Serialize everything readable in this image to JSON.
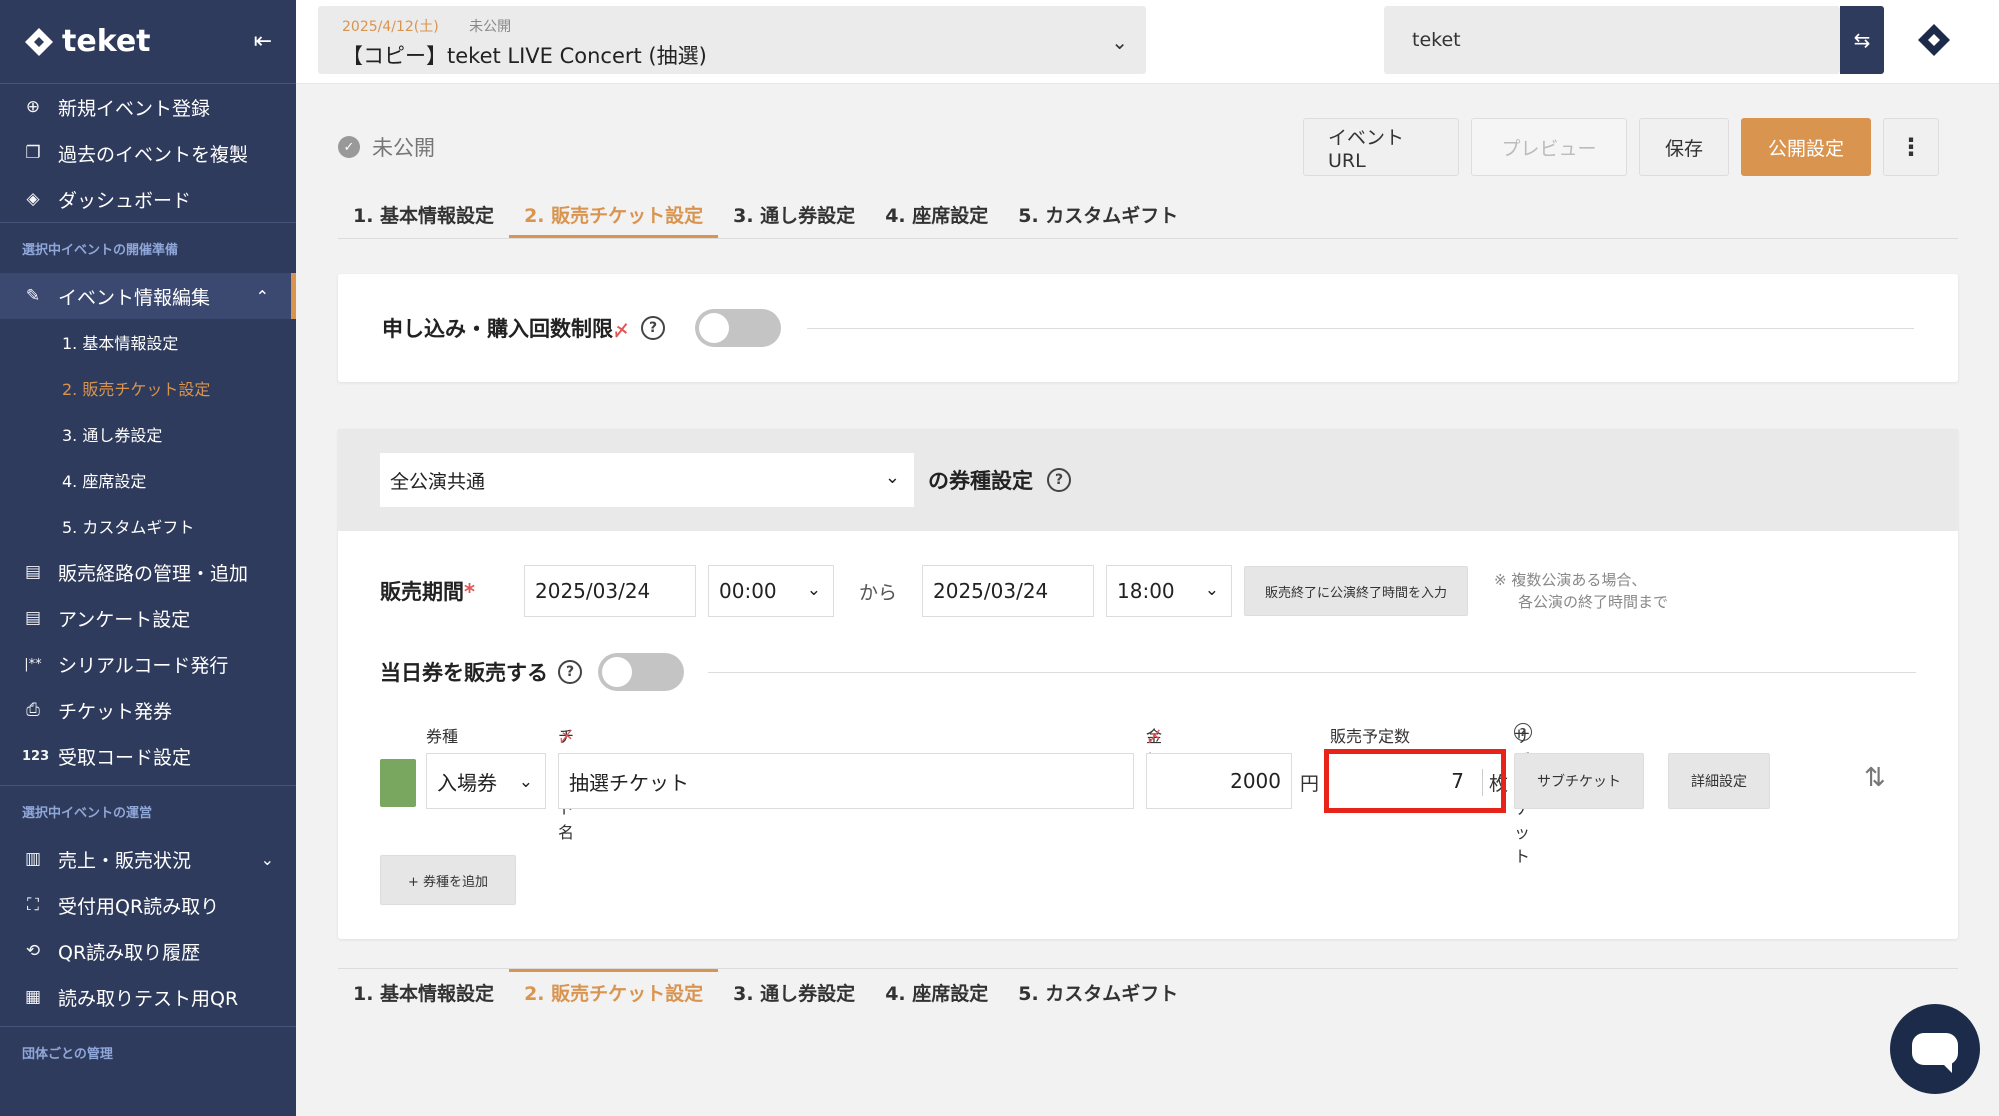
{
  "app": {
    "brand": "teket"
  },
  "sidebar": {
    "items_top": [
      {
        "label": "新規イベント登録",
        "icon": "plus-circle-icon"
      },
      {
        "label": "過去のイベントを複製",
        "icon": "copy-icon"
      },
      {
        "label": "ダッシュボード",
        "icon": "layers-icon"
      }
    ],
    "section_prep": "選択中イベントの開催準備",
    "edit_label": "イベント情報編集",
    "edit_subitems": [
      "1. 基本情報設定",
      "2. 販売チケット設定",
      "3. 通し券設定",
      "4. 座席設定",
      "5. カスタムギフト"
    ],
    "items_prep": [
      {
        "label": "販売経路の管理・追加",
        "icon": "doc-icon"
      },
      {
        "label": "アンケート設定",
        "icon": "doc-icon"
      },
      {
        "label": "シリアルコード発行",
        "icon": "asterisk-icon"
      },
      {
        "label": "チケット発券",
        "icon": "ticket-icon"
      },
      {
        "label": "受取コード設定",
        "icon": "123-icon"
      }
    ],
    "section_ops": "選択中イベントの運営",
    "items_ops": [
      {
        "label": "売上・販売状況",
        "icon": "bar-chart-icon"
      },
      {
        "label": "受付用QR読み取り",
        "icon": "qr-scan-icon"
      },
      {
        "label": "QR読み取り履歴",
        "icon": "history-icon"
      },
      {
        "label": "読み取りテスト用QR",
        "icon": "qr-icon"
      }
    ],
    "section_org": "団体ごとの管理"
  },
  "header": {
    "event_date": "2025/4/12(土)",
    "event_status": "未公開",
    "event_title": "【コピー】teket LIVE Concert (抽選)",
    "org_name": "teket"
  },
  "status": {
    "label": "未公開"
  },
  "actions": {
    "event_url": "イベントURL",
    "preview": "プレビュー",
    "save": "保存",
    "publish": "公開設定"
  },
  "tabs": [
    "1. 基本情報設定",
    "2. 販売チケット設定",
    "3. 通し券設定",
    "4. 座席設定",
    "5. カスタムギフト"
  ],
  "limit": {
    "label": "申し込み・購入回数制限",
    "req": "〆"
  },
  "ticket_settings": {
    "scope_value": "全公演共通",
    "suffix_label": "の券種設定",
    "period_label": "販売期間",
    "period_req": "*",
    "start_date": "2025/03/24",
    "start_time": "00:00",
    "from_label": "から",
    "end_date": "2025/03/24",
    "end_time": "18:00",
    "end_fill_button": "販売終了に公演終了時間を入力",
    "note_line1": "※ 複数公演ある場合、",
    "note_line2": "各公演の終了時間まで",
    "same_day_label": "当日券を販売する",
    "col_type": "券種",
    "col_name": "チケット名",
    "col_price": "金額",
    "col_qty": "販売予定数",
    "col_sub": "サブチケット",
    "req_mark": "〆",
    "row": {
      "type": "入場券",
      "name": "抽選チケット",
      "price": "2000",
      "price_unit": "円",
      "qty": "7",
      "qty_unit": "枚",
      "sub_button": "サブチケット",
      "detail_button": "詳細設定"
    },
    "add_button": "+ 券種を追加"
  },
  "colors": {
    "accent": "#d9944f",
    "sidebar": "#2f3b5c",
    "highlight": "#e8231a",
    "chip": "#7aa75f"
  }
}
